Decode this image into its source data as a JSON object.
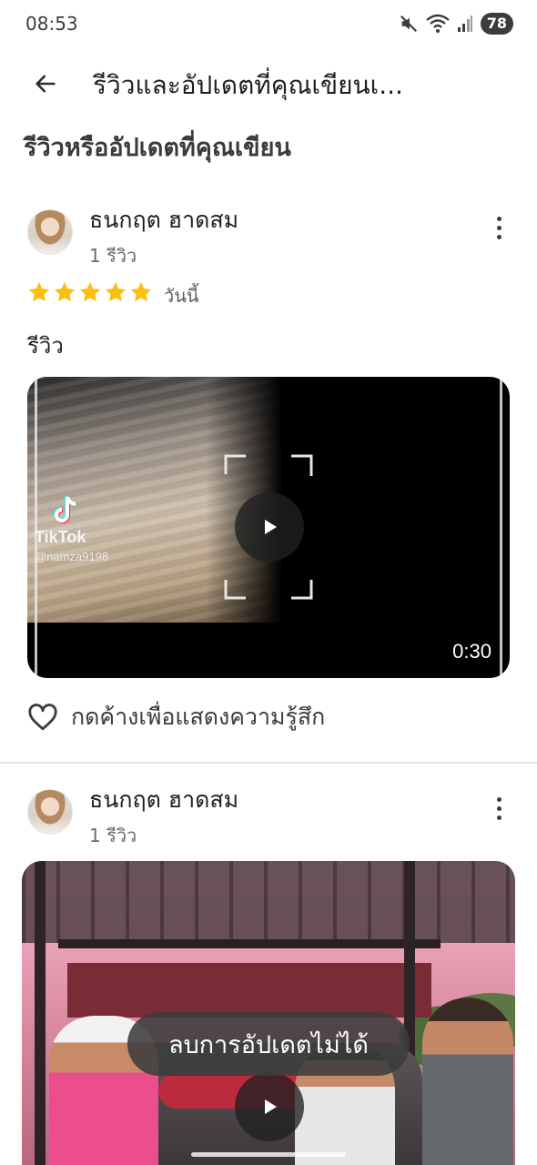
{
  "status_bar": {
    "time": "08:53",
    "battery": "78"
  },
  "app_bar": {
    "title": "รีวิวและอัปเดตที่คุณเขียนเ..."
  },
  "section_title": "รีวิวหรืออัปเดตที่คุณเขียน",
  "reviews": [
    {
      "author": "ธนกฤต ฮาดสม",
      "meta": "1 รีวิว",
      "rating": 5,
      "date": "วันนี้",
      "text": "รีวิว",
      "video": {
        "duration": "0:30",
        "watermark_brand": "TikTok",
        "watermark_user": "@namza9198"
      },
      "reaction_label": "กดค้างเพื่อแสดงความรู้สึก"
    },
    {
      "author": "ธนกฤต ฮาดสม",
      "meta": "1 รีวิว"
    }
  ],
  "toast": "ลบการอัปเดตไม่ได้",
  "colors": {
    "star": "#f9c012",
    "toast_bg": "#3c3c3c",
    "divider": "#e3e3e3"
  },
  "icons": [
    "mute-icon",
    "wifi-icon",
    "signal-icon",
    "back-arrow-icon",
    "more-vert-icon",
    "star-icon",
    "play-icon",
    "heart-outline-icon",
    "tiktok-icon"
  ]
}
